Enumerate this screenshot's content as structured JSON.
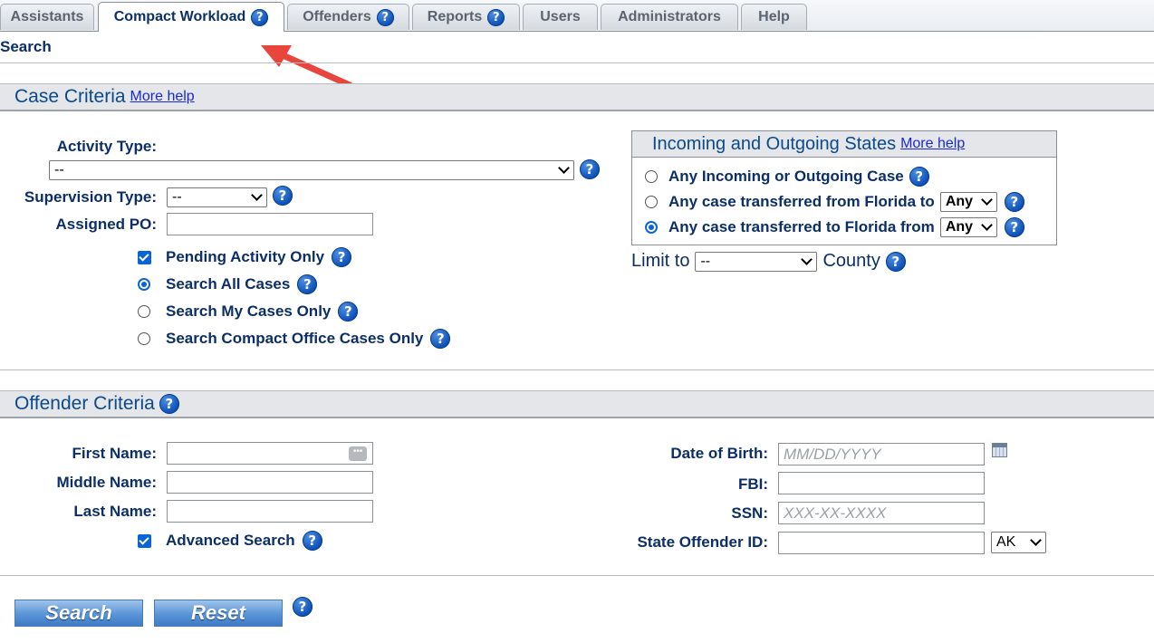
{
  "tabs": [
    {
      "label": "Assistants",
      "help": false
    },
    {
      "label": "Compact Workload",
      "help": true
    },
    {
      "label": "Offenders",
      "help": true
    },
    {
      "label": "Reports",
      "help": true
    },
    {
      "label": "Users",
      "help": false
    },
    {
      "label": "Administrators",
      "help": false
    },
    {
      "label": "Help",
      "help": false
    }
  ],
  "active_tab": "Compact Workload",
  "page_title": "Search",
  "help_glyph": "?",
  "case_criteria": {
    "title": "Case Criteria",
    "more_help": "More help",
    "activity_type_label": "Activity Type:",
    "activity_type_value": "--",
    "supervision_type_label": "Supervision Type:",
    "supervision_type_value": "--",
    "assigned_po_label": "Assigned PO:",
    "assigned_po_value": "",
    "pending_activity_only": "Pending Activity Only",
    "pending_activity_checked": true,
    "scope_options": [
      "Search All Cases",
      "Search My Cases Only",
      "Search Compact Office Cases Only"
    ],
    "scope_selected": "Search All Cases"
  },
  "states": {
    "title": "Incoming and Outgoing States",
    "more_help": "More help",
    "options": [
      {
        "label": "Any Incoming or Outgoing Case",
        "select": null
      },
      {
        "label": "Any case transferred from Florida to",
        "select": "Any"
      },
      {
        "label": "Any case transferred to Florida from",
        "select": "Any"
      }
    ],
    "selected_index": 2,
    "limit_to_label": "Limit to",
    "limit_to_value": "--",
    "county_label": "County"
  },
  "offender_criteria": {
    "title": "Offender Criteria",
    "first_name_label": "First Name:",
    "middle_name_label": "Middle Name:",
    "last_name_label": "Last Name:",
    "advanced_search": "Advanced Search",
    "advanced_search_checked": true,
    "dob_label": "Date of Birth:",
    "dob_placeholder": "MM/DD/YYYY",
    "fbi_label": "FBI:",
    "ssn_label": "SSN:",
    "ssn_placeholder": "XXX-XX-XXXX",
    "state_offender_id_label": "State Offender ID:",
    "state_value": "AK"
  },
  "buttons": {
    "search": "Search",
    "reset": "Reset"
  },
  "colors": {
    "accent": "#0b2f66",
    "help_blue": "#0b4fb8",
    "arrow": "#e8453c"
  }
}
